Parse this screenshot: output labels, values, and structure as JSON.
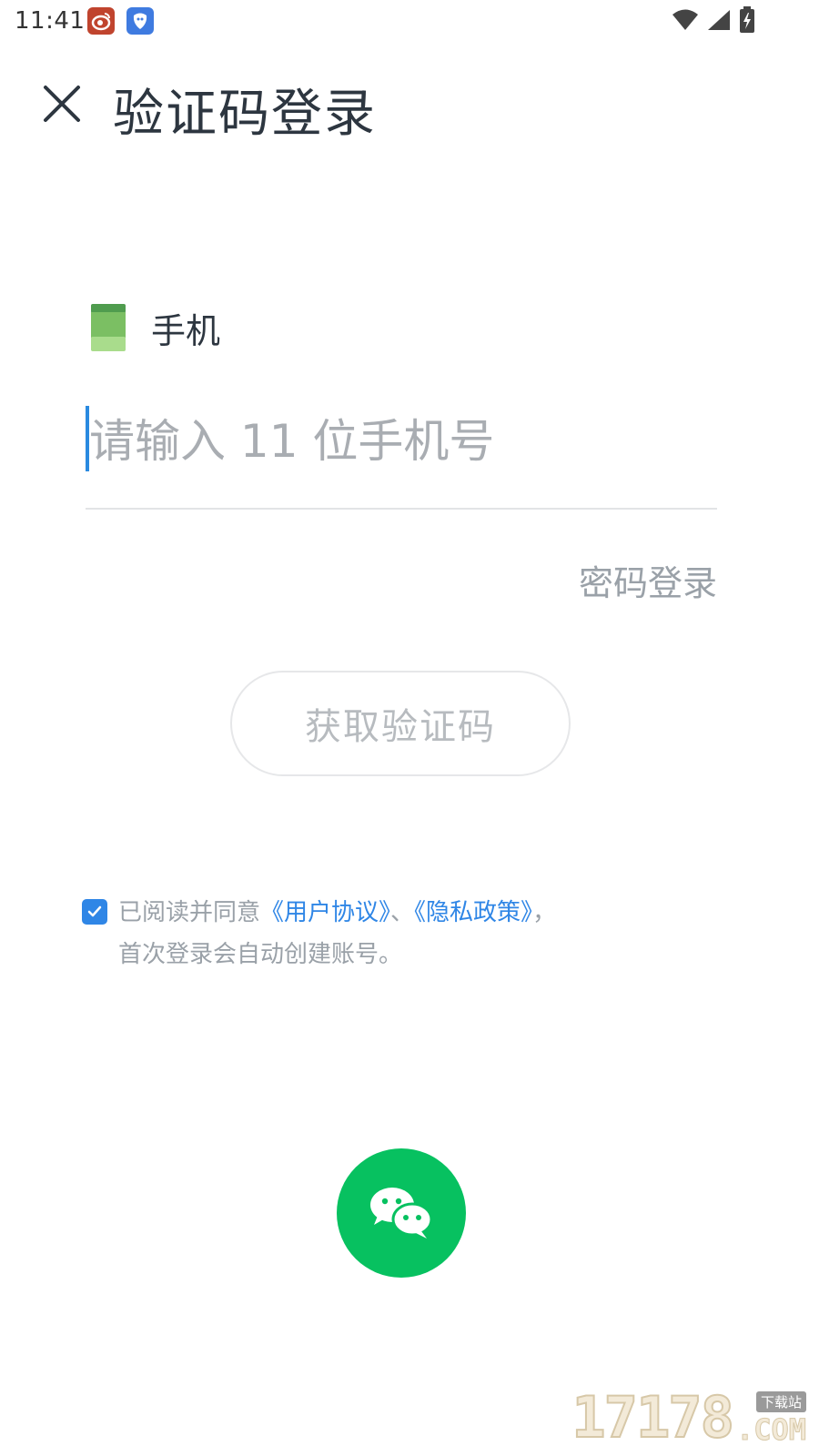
{
  "status_bar": {
    "time": "11:41",
    "notifications": [
      "weibo-icon",
      "bird-app-icon"
    ],
    "indicators": [
      "wifi-icon",
      "cell-signal-icon",
      "battery-charging-icon"
    ]
  },
  "header": {
    "close_icon": "close-icon",
    "title": "验证码登录"
  },
  "phone": {
    "label": "手机",
    "input_value": "",
    "placeholder": "请输入 11 位手机号"
  },
  "password_login": "密码登录",
  "get_code_button": "获取验证码",
  "agreement": {
    "checked": true,
    "prefix": "已阅读并同意",
    "user_agreement": "《用户协议》",
    "separator": "、",
    "privacy_policy": "《隐私政策》",
    "suffix": "，",
    "note": "首次登录会自动创建账号。"
  },
  "wechat": {
    "icon": "wechat-icon",
    "color": "#07c160"
  },
  "watermark": {
    "number": "17178",
    "site": "下载站",
    "domain": ".COM"
  },
  "colors": {
    "accent": "#2f86e6",
    "caret": "#2a8ae0",
    "title_text": "#2d3640",
    "muted_text": "#9aa1a8"
  }
}
